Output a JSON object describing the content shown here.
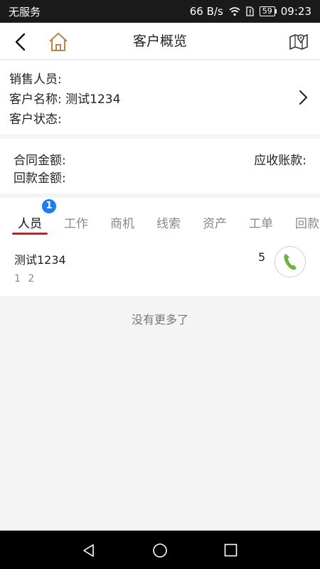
{
  "status_bar": {
    "carrier": "无服务",
    "speed": "66 B/s",
    "battery": "59",
    "time": "09:23"
  },
  "navbar": {
    "title": "客户概览",
    "back_icon": "back-arrow-icon",
    "home_icon": "home-icon",
    "map_icon": "map-pin-icon"
  },
  "customer_info": {
    "sales_label": "销售人员:",
    "sales_value": "",
    "name_label": "客户名称:",
    "name_value": "测试1234",
    "status_label": "客户状态:",
    "status_value": ""
  },
  "finance": {
    "contract_label": "合同金额:",
    "receivable_label": "应收账款:",
    "payment_label": "回款金额:"
  },
  "tabs": {
    "items": [
      {
        "label": "人员",
        "active": true,
        "badge": "1"
      },
      {
        "label": "工作"
      },
      {
        "label": "商机"
      },
      {
        "label": "线索"
      },
      {
        "label": "资产"
      },
      {
        "label": "工单"
      },
      {
        "label": "回款"
      }
    ]
  },
  "contacts": [
    {
      "name": "测试1234",
      "sub": "1 2",
      "count": "5",
      "icon": "phone-icon"
    }
  ],
  "footer_text": "没有更多了",
  "colors": {
    "accent": "#e0161d",
    "badge": "#1b7ef2",
    "home_icon": "#b6854a",
    "phone_icon": "#6cb33f"
  }
}
